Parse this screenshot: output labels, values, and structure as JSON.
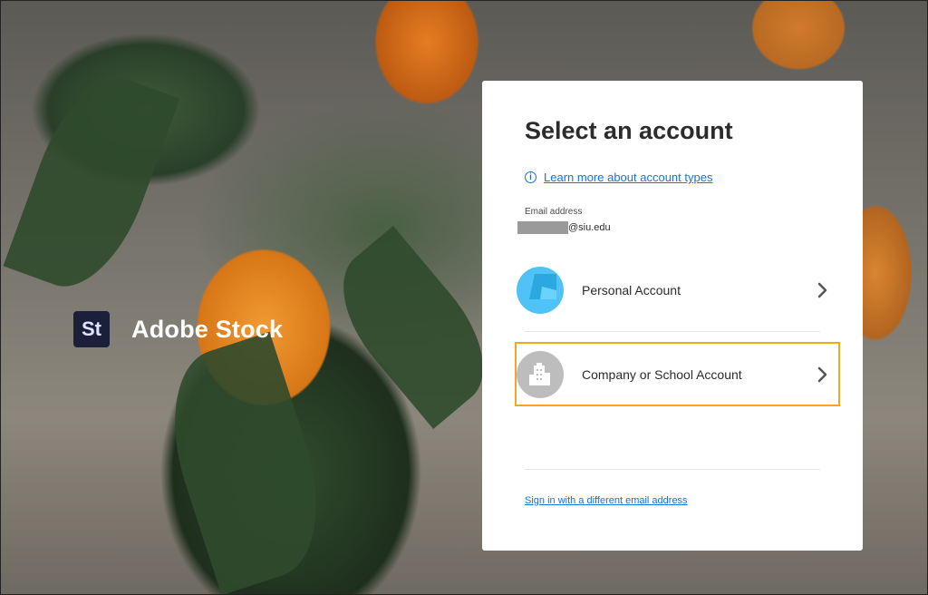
{
  "brand": {
    "badge": "St",
    "name": "Adobe Stock"
  },
  "card": {
    "title": "Select an account",
    "learn_more": "Learn more about account types",
    "email_label": "Email address",
    "email_domain": "@siu.edu",
    "options": [
      {
        "label": "Personal Account",
        "icon": "personal-account-icon"
      },
      {
        "label": "Company or School Account",
        "icon": "building-icon"
      }
    ],
    "different_email": "Sign in with a different email address"
  },
  "colors": {
    "accent": "#1473e6",
    "highlight": "#f5a623",
    "personal": "#4fc3f7",
    "company": "#bdbdbd"
  }
}
